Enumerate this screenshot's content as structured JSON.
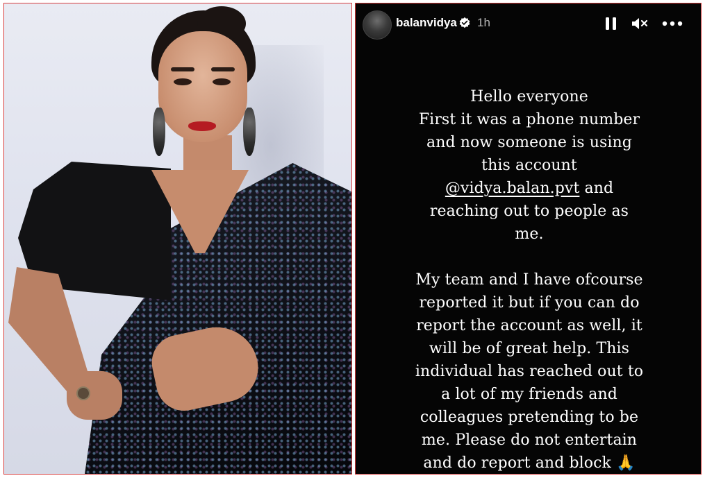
{
  "story": {
    "username": "balanvidya",
    "timestamp": "1h",
    "icons": {
      "verified": "verified-badge-icon",
      "pause": "pause-icon",
      "mute": "mute-icon",
      "more": "more-options-icon"
    },
    "paragraph_1": [
      "Hello everyone",
      "First it was a phone number",
      "and now someone is using",
      "this account"
    ],
    "mention_line": {
      "mention": "@vidya.balan.pvt",
      "suffix": " and"
    },
    "paragraph_1_end": [
      "reaching out to people as",
      "me."
    ],
    "paragraph_2": [
      "My team and I have ofcourse",
      "reported it but if you can do",
      "report the account as well, it",
      "will be of great help. This",
      "individual has reached out to",
      "a lot of my friends and",
      "colleagues pretending to be",
      "me. Please do not entertain",
      "and do report and block 🙏"
    ]
  },
  "colors": {
    "story_background": "#050505",
    "panel_border": "#d63a3a",
    "verified_blue": "#ffffff"
  }
}
